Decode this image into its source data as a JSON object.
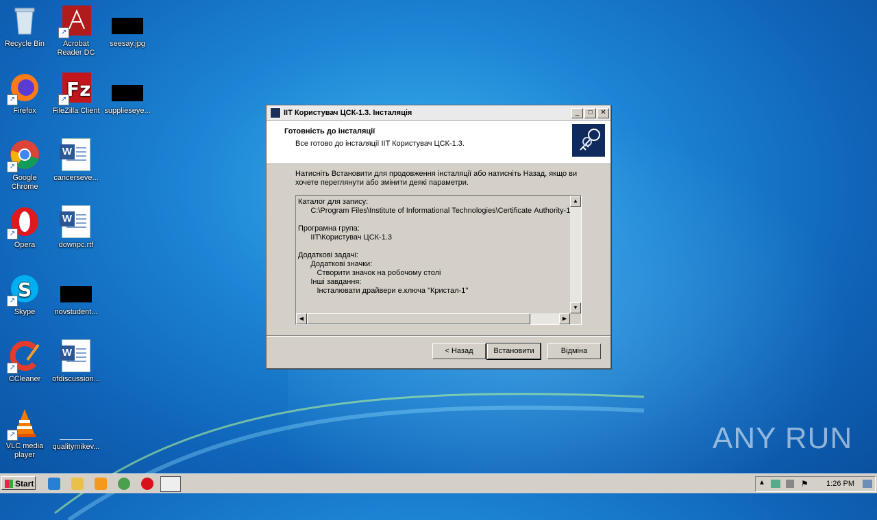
{
  "desktop": {
    "icons": [
      {
        "label": "Recycle Bin"
      },
      {
        "label": "Acrobat Reader DC"
      },
      {
        "label": "seesay.jpg"
      },
      {
        "label": "Firefox"
      },
      {
        "label": "FileZilla Client"
      },
      {
        "label": "supplieseye..."
      },
      {
        "label": "Google Chrome"
      },
      {
        "label": "cancerseve..."
      },
      {
        "label": "Opera"
      },
      {
        "label": "downpc.rtf"
      },
      {
        "label": "Skype"
      },
      {
        "label": "novstudent..."
      },
      {
        "label": "CCleaner"
      },
      {
        "label": "ofdiscussion..."
      },
      {
        "label": "VLC media player"
      },
      {
        "label": "qualitymikev..."
      }
    ]
  },
  "dialog": {
    "title": "IIT Користувач ЦСК-1.3. Інсталяція",
    "header_title": "Готовність до інсталяції",
    "header_subtitle": "Все готово до інсталяції IIT Користувач ЦСК-1.3.",
    "intro": "Натисніть Встановити для продовження інсталяції або натисніть Назад, якщо ви хочете переглянути або змінити деякі параметри.",
    "memo_lines": [
      "Каталог для запису:",
      "      C:\\Program Files\\Institute of Informational Technologies\\Certificate Authority-1.3",
      "",
      "Програмна група:",
      "      IIT\\Користувач ЦСК-1.3",
      "",
      "Додаткові задачі:",
      "      Додаткові значки:",
      "         Створити значок на робочому столі",
      "      Інші завдання:",
      "         Інсталювати драйвери е.ключа \"Кристал-1\""
    ],
    "buttons": {
      "back": "< Назад",
      "install": "Встановити",
      "cancel": "Відміна"
    }
  },
  "taskbar": {
    "start_label": "Start",
    "clock": "1:26 PM"
  },
  "watermark": "ANY RUN"
}
